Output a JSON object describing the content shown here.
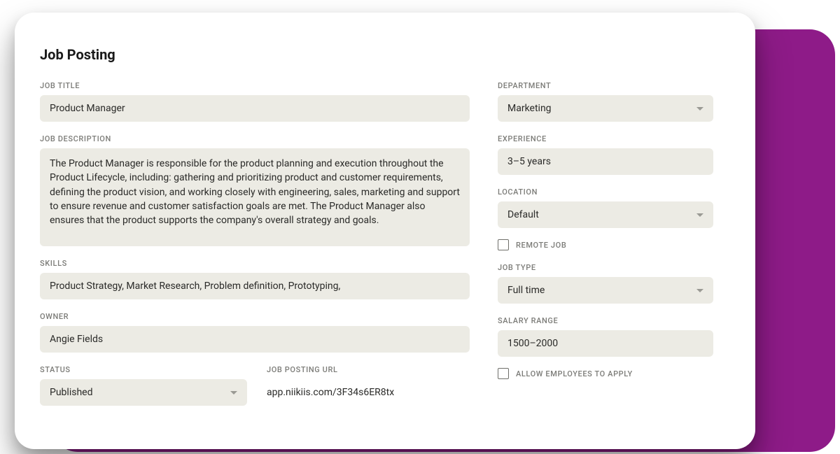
{
  "pageTitle": "Job Posting",
  "left": {
    "jobTitle": {
      "label": "JOB TITLE",
      "value": "Product Manager"
    },
    "jobDescription": {
      "label": "JOB DESCRIPTION",
      "value": "The Product Manager is responsible for the product planning and execution throughout the Product Lifecycle, including: gathering and prioritizing product and customer requirements, defining the product vision, and working closely with engineering, sales, marketing and support to ensure revenue and customer satisfaction goals are met. The Product Manager also ensures that the product supports the company's overall strategy and goals."
    },
    "skills": {
      "label": "SKILLS",
      "value": "Product Strategy, Market Research, Problem definition, Prototyping,"
    },
    "owner": {
      "label": "OWNER",
      "value": "Angie Fields"
    },
    "status": {
      "label": "STATUS",
      "value": "Published"
    },
    "postingUrl": {
      "label": "JOB POSTING URL",
      "value": "app.niikiis.com/3F34s6ER8tx"
    }
  },
  "right": {
    "department": {
      "label": "DEPARTMENT",
      "value": "Marketing"
    },
    "experience": {
      "label": "EXPERIENCE",
      "value": "3–5 years"
    },
    "location": {
      "label": "LOCATION",
      "value": "Default"
    },
    "remoteJob": {
      "label": "REMOTE JOB",
      "checked": false
    },
    "jobType": {
      "label": "JOB TYPE",
      "value": "Full time"
    },
    "salaryRange": {
      "label": "SALARY RANGE",
      "value": "1500–2000"
    },
    "allowEmployees": {
      "label": "ALLOW EMPLOYEES TO APPLY",
      "checked": false
    }
  }
}
